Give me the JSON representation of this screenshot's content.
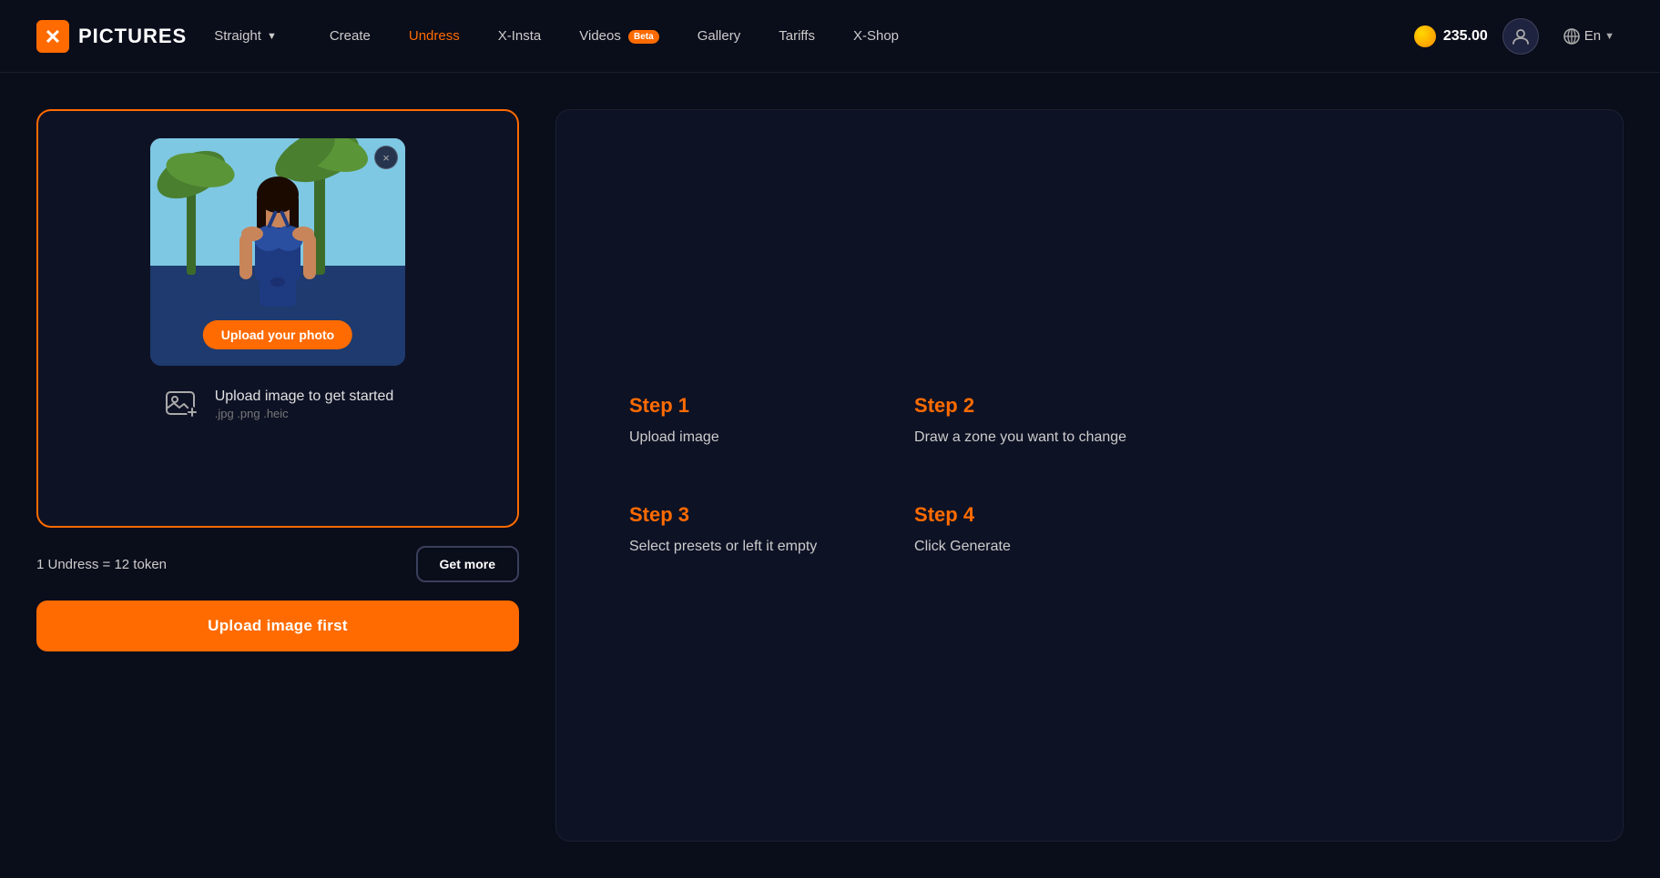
{
  "header": {
    "logo_text": "PICTURES",
    "mode_label": "Straight",
    "nav_items": [
      {
        "id": "create",
        "label": "Create",
        "active": false,
        "badge": null
      },
      {
        "id": "undress",
        "label": "Undress",
        "active": true,
        "badge": null
      },
      {
        "id": "x-insta",
        "label": "X-Insta",
        "active": false,
        "badge": null
      },
      {
        "id": "videos",
        "label": "Videos",
        "active": false,
        "badge": "Beta"
      },
      {
        "id": "gallery",
        "label": "Gallery",
        "active": false,
        "badge": null
      },
      {
        "id": "tariffs",
        "label": "Tariffs",
        "active": false,
        "badge": null
      },
      {
        "id": "x-shop",
        "label": "X-Shop",
        "active": false,
        "badge": null
      }
    ],
    "coins_amount": "235.00",
    "lang": "En"
  },
  "upload_card": {
    "upload_overlay_label": "Upload your photo",
    "close_label": "×",
    "upload_main_text": "Upload image to get started",
    "upload_sub_text": ".jpg .png .heic"
  },
  "token_row": {
    "token_info": "1 Undress = 12 token",
    "get_more_label": "Get more"
  },
  "cta_button": {
    "label": "Upload image first"
  },
  "steps": [
    {
      "id": "step1",
      "title": "Step 1",
      "desc": "Upload image"
    },
    {
      "id": "step2",
      "title": "Step 2",
      "desc": "Draw a zone you want to change"
    },
    {
      "id": "step3",
      "title": "Step 3",
      "desc": "Select presets or left it empty"
    },
    {
      "id": "step4",
      "title": "Step 4",
      "desc": "Click Generate"
    }
  ]
}
